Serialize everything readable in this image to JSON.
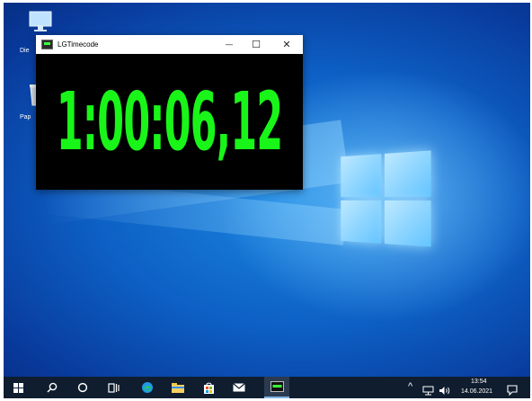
{
  "desktop": {
    "icons": [
      {
        "label": "Die",
        "icon": "this-pc-icon"
      },
      {
        "label": "Pap",
        "icon": "recycle-bin-icon"
      }
    ]
  },
  "window": {
    "title": "LGTimecode",
    "timecode": "1:00:06,12",
    "timecode_color": "#19f519",
    "minimize_glyph": "—",
    "maximize_glyph": "☐",
    "close_glyph": "✕"
  },
  "taskbar": {
    "items": [
      "start-icon",
      "search-icon",
      "cortana-icon",
      "task-view-icon",
      "edge-icon",
      "file-explorer-icon",
      "store-icon",
      "mail-icon",
      "lgtimecode-taskbar-icon"
    ],
    "tray_chevron": "^",
    "time": "13:54",
    "date": "14.06.2021"
  }
}
